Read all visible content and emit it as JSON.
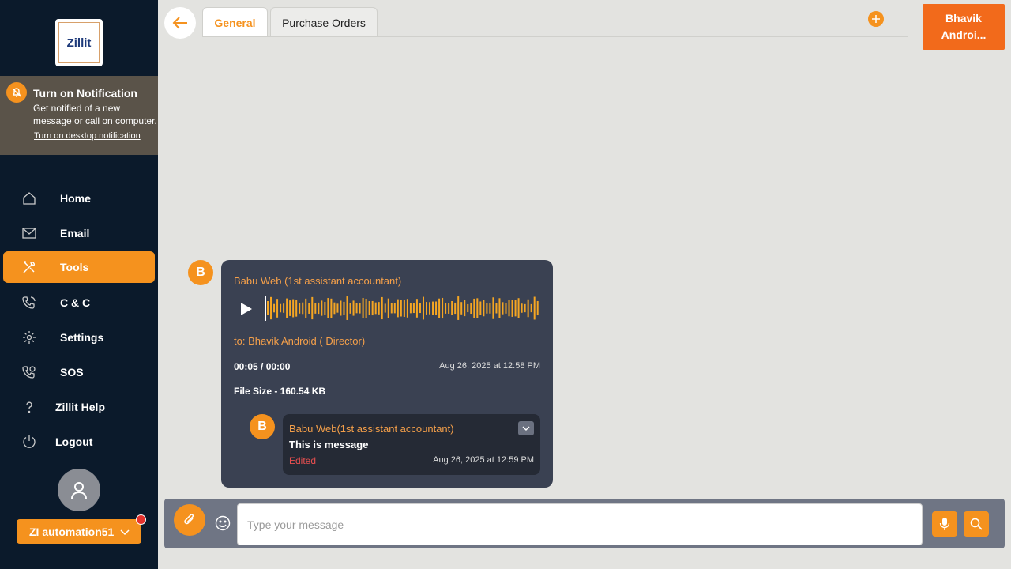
{
  "app": {
    "logo_text": "Zillit"
  },
  "notification": {
    "title": "Turn on Notification",
    "body": "Get notified of a new message or call on computer.",
    "link": "Turn on desktop notification"
  },
  "sidebar": {
    "items": [
      {
        "label": "Home",
        "icon": "home-icon"
      },
      {
        "label": "Email",
        "icon": "mail-icon"
      },
      {
        "label": "Tools",
        "icon": "tools-icon",
        "active": true
      },
      {
        "label": "C & C",
        "icon": "phone-icon"
      },
      {
        "label": "Settings",
        "icon": "gear-icon"
      },
      {
        "label": "SOS",
        "icon": "sos-phone-icon"
      },
      {
        "label": "Zillit Help",
        "icon": "help-icon"
      },
      {
        "label": "Logout",
        "icon": "power-icon"
      }
    ],
    "user": {
      "name": "ZI automation51"
    }
  },
  "header": {
    "tabs": [
      {
        "label": "General",
        "active": true
      },
      {
        "label": "Purchase Orders"
      }
    ],
    "contact": "Bhavik Androi..."
  },
  "message": {
    "avatar_initial": "B",
    "sender": "Babu Web (1st assistant accountant)",
    "to": "to: Bhavik Android ( Director)",
    "duration": "00:05 / 00:00",
    "timestamp": "Aug 26, 2025 at 12:58 PM",
    "file_size": "File Size - 160.54 KB",
    "reply": {
      "avatar_initial": "B",
      "sender": "Babu Web(1st assistant accountant)",
      "text": "This is message",
      "status": "Edited",
      "timestamp": "Aug 26, 2025 at 12:59 PM"
    }
  },
  "composer": {
    "placeholder": "Type your message"
  },
  "colors": {
    "accent": "#f5921e",
    "sidebar": "#0b1a2b",
    "bubble": "#3a4152"
  }
}
